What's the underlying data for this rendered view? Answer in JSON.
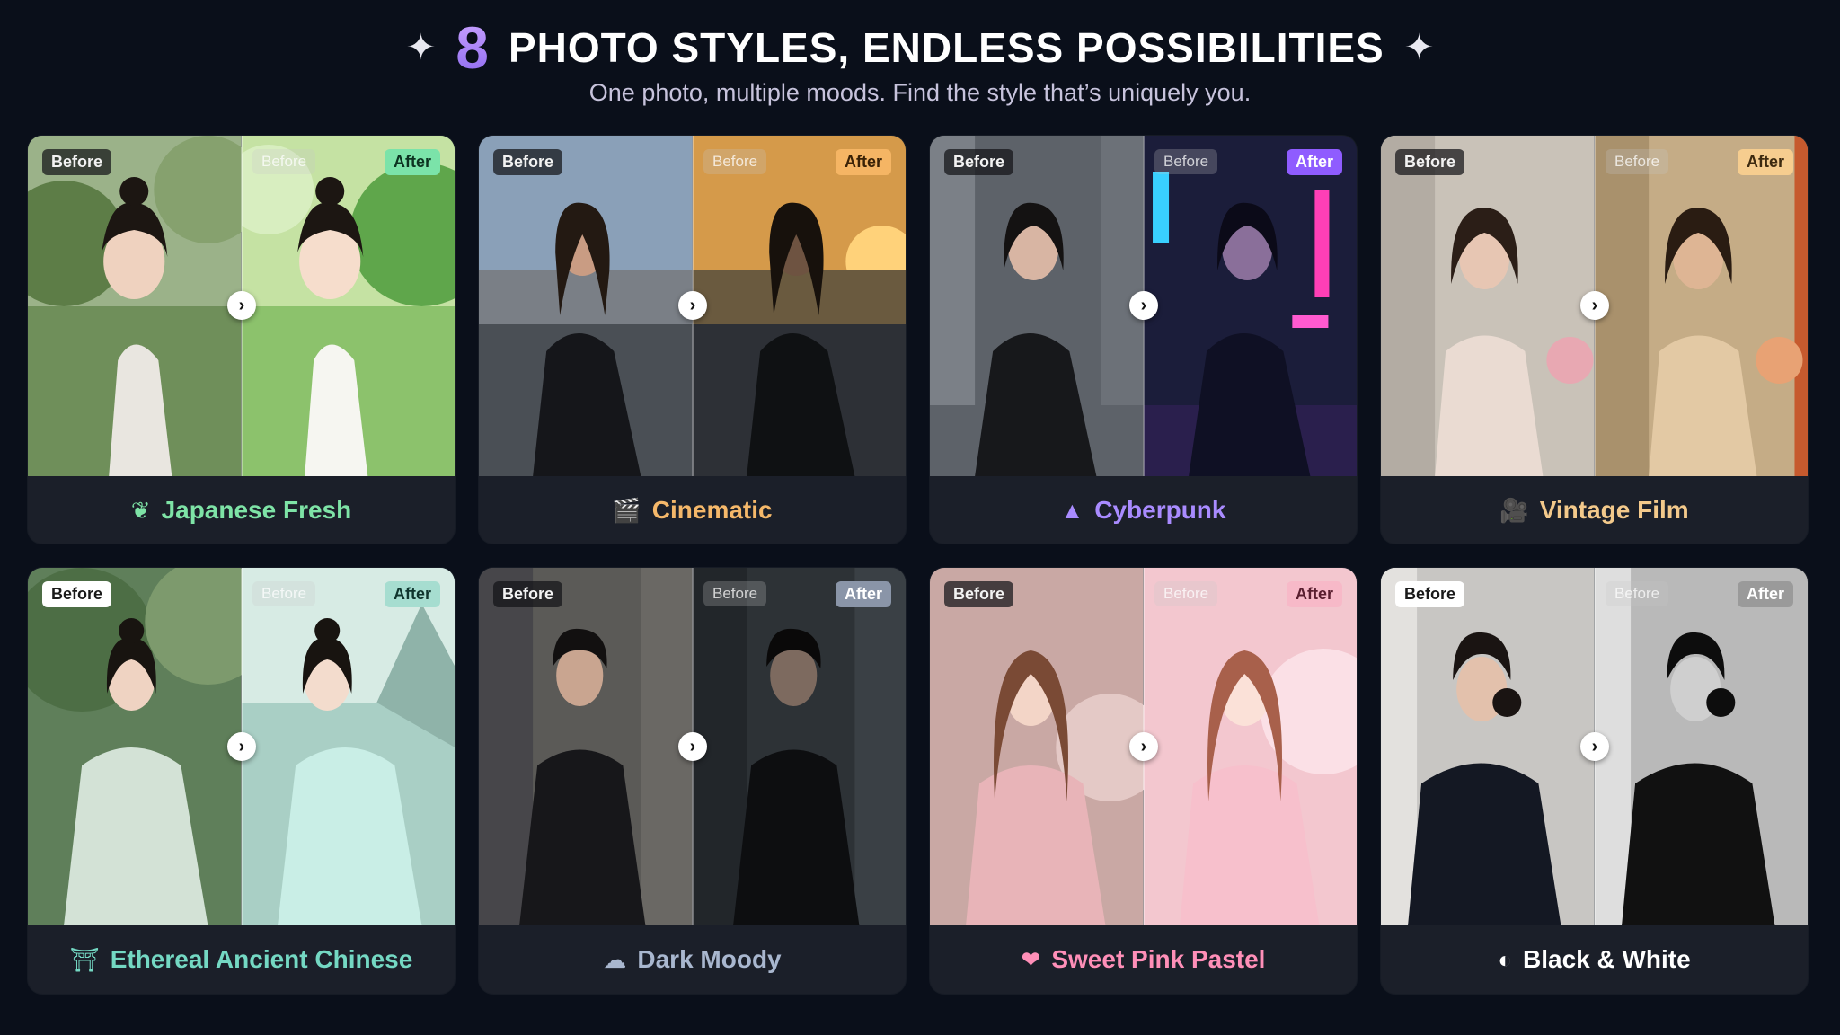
{
  "header": {
    "sparkle_left": "✦",
    "sparkle_right": "✦",
    "number": "8",
    "title": "PHOTO STYLES, ENDLESS POSSIBILITIES",
    "subtitle": "One photo, multiple moods. Find the style that’s uniquely you."
  },
  "badges": {
    "before": "Before",
    "after": "After"
  },
  "cards": [
    {
      "label": "Japanese Fresh",
      "icon": "leaf-icon",
      "icon_glyph": "❦",
      "color": "#7ee3a6",
      "ghost": "Before",
      "after_bg": "#7be3a9",
      "after_fg": "#0d3321"
    },
    {
      "label": "Cinematic",
      "icon": "clapperboard-icon",
      "icon_glyph": "🎬",
      "color": "#f5b86a",
      "ghost": "Before",
      "after_bg": "#f5b564",
      "after_fg": "#3a2206"
    },
    {
      "label": "Cyberpunk",
      "icon": "triangle-icon",
      "icon_glyph": "▲",
      "color": "#a98bff",
      "ghost": "Before",
      "after_bg": "#8f5cff",
      "after_fg": "#ffffff"
    },
    {
      "label": "Vintage Film",
      "icon": "film-camera-icon",
      "icon_glyph": "🎥",
      "color": "#f3c98b",
      "ghost": "Before",
      "after_bg": "#f6cd8f",
      "after_fg": "#3d2a10"
    },
    {
      "label": "Ethereal Ancient Chinese",
      "icon": "pagoda-icon",
      "icon_glyph": "⛩",
      "color": "#74d8c3",
      "ghost": "Before",
      "after_bg": "#a6ddd0",
      "after_fg": "#10352e"
    },
    {
      "label": "Dark Moody",
      "icon": "cloud-rain-icon",
      "icon_glyph": "☁",
      "color": "#a9b7cf",
      "ghost": "Before",
      "after_bg": "#8a95a8",
      "after_fg": "#ffffff"
    },
    {
      "label": "Sweet Pink Pastel",
      "icon": "heart-icon",
      "icon_glyph": "❤",
      "color": "#ff8fb8",
      "ghost": "Before",
      "after_bg": "#f7b9c8",
      "after_fg": "#5a1f30"
    },
    {
      "label": "Black & White",
      "icon": "half-circle-icon",
      "icon_glyph": "◐",
      "color": "#ffffff",
      "ghost": "Before",
      "after_bg": "#9a9a9a",
      "after_fg": "#ffffff"
    }
  ]
}
